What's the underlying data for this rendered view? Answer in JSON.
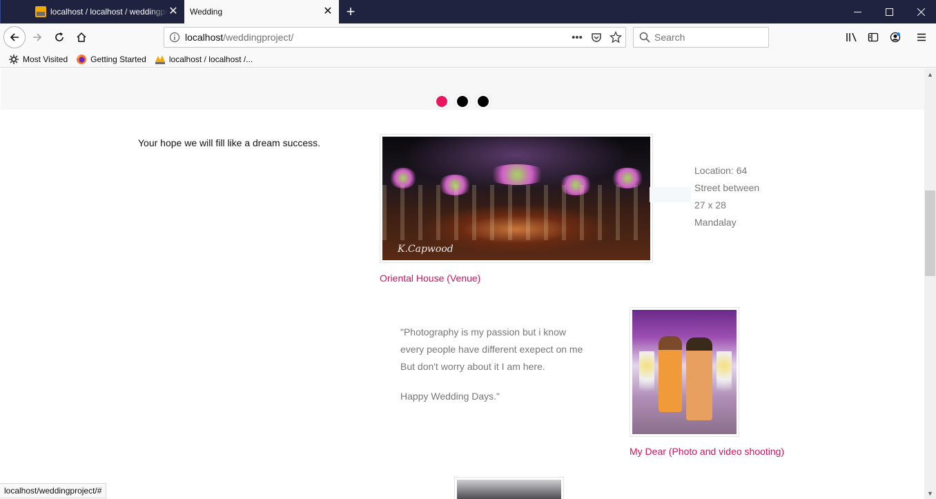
{
  "browser": {
    "tabs": [
      {
        "title": "localhost / localhost / weddingproject",
        "active": false
      },
      {
        "title": "Wedding",
        "active": true
      }
    ],
    "new_tab_symbol": "+",
    "url": {
      "host": "localhost",
      "path": "/weddingproject/"
    },
    "search_placeholder": "Search",
    "bookmarks": [
      {
        "label": "Most Visited",
        "icon": "gear-icon"
      },
      {
        "label": "Getting Started",
        "icon": "firefox-icon"
      },
      {
        "label": "localhost / localhost /...",
        "icon": "phpmyadmin-icon"
      }
    ],
    "status_url": "localhost/weddingproject/#"
  },
  "page": {
    "slider": {
      "dot_count": 3,
      "active_index": 0,
      "active_color": "#e8175d"
    },
    "tagline": "Your hope we will fill like a dream success.",
    "venue": {
      "signature": "K.Capwood",
      "caption": "Oriental House (Venue)",
      "location_lines": [
        "Location: 64",
        "Street between",
        "27 x 28",
        "Mandalay"
      ]
    },
    "photographer": {
      "quote_lines": [
        "\"Photography is my passion but i know",
        "every people have different exepect on me",
        "But don't worry about it I am here."
      ],
      "quote_closing": "Happy Wedding Days.\"",
      "caption": "My Dear (Photo and video shooting)"
    },
    "accent_color": "#d1105f"
  }
}
